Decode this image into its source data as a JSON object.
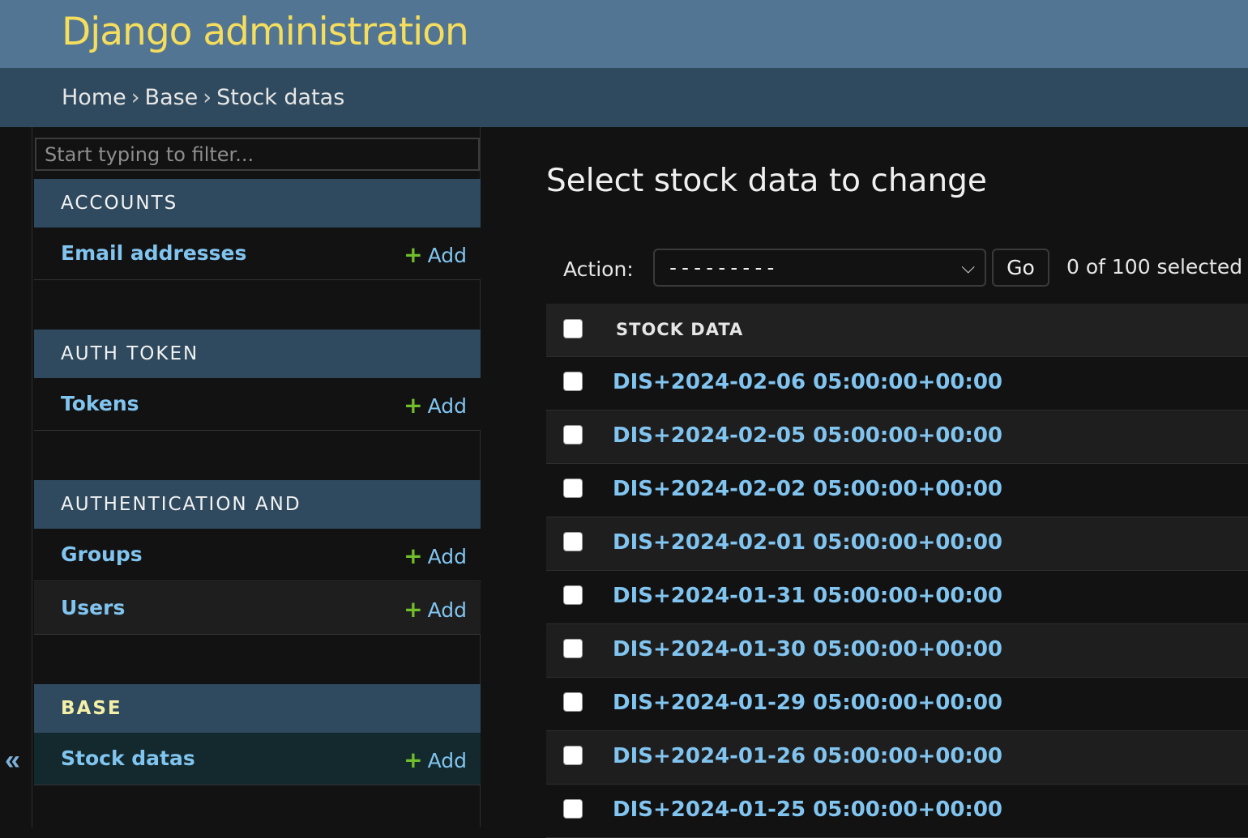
{
  "header": {
    "site_title": "Django administration"
  },
  "breadcrumbs": [
    "Home",
    "Base",
    "Stock datas"
  ],
  "sidebar": {
    "filter_placeholder": "Start typing to filter...",
    "toggle_glyph": "«",
    "modules": [
      {
        "caption": "ACCOUNTS",
        "models": [
          {
            "name": "Email addresses",
            "add": "Add"
          }
        ]
      },
      {
        "caption": "AUTH TOKEN",
        "models": [
          {
            "name": "Tokens",
            "add": "Add"
          }
        ]
      },
      {
        "caption": "AUTHENTICATION AND AUTHORIZATION",
        "models": [
          {
            "name": "Groups",
            "add": "Add"
          },
          {
            "name": "Users",
            "add": "Add"
          }
        ]
      },
      {
        "caption": "BASE",
        "models": [
          {
            "name": "Stock datas",
            "add": "Add"
          }
        ]
      }
    ]
  },
  "main": {
    "title": "Select stock data to change",
    "action_label": "Action:",
    "action_selected": "---------",
    "go_label": "Go",
    "selected_count": "0 of 100 selected",
    "column_header": "STOCK DATA",
    "rows": [
      "DIS+2024-02-06 05:00:00+00:00",
      "DIS+2024-02-05 05:00:00+00:00",
      "DIS+2024-02-02 05:00:00+00:00",
      "DIS+2024-02-01 05:00:00+00:00",
      "DIS+2024-01-31 05:00:00+00:00",
      "DIS+2024-01-30 05:00:00+00:00",
      "DIS+2024-01-29 05:00:00+00:00",
      "DIS+2024-01-26 05:00:00+00:00",
      "DIS+2024-01-25 05:00:00+00:00"
    ]
  },
  "colors": {
    "header_bg": "#517593",
    "breadcrumb_bg": "#2f4a5e",
    "title_yellow": "#f5dd5d",
    "link_blue": "#81c4ef",
    "add_green": "#70bf2b"
  }
}
